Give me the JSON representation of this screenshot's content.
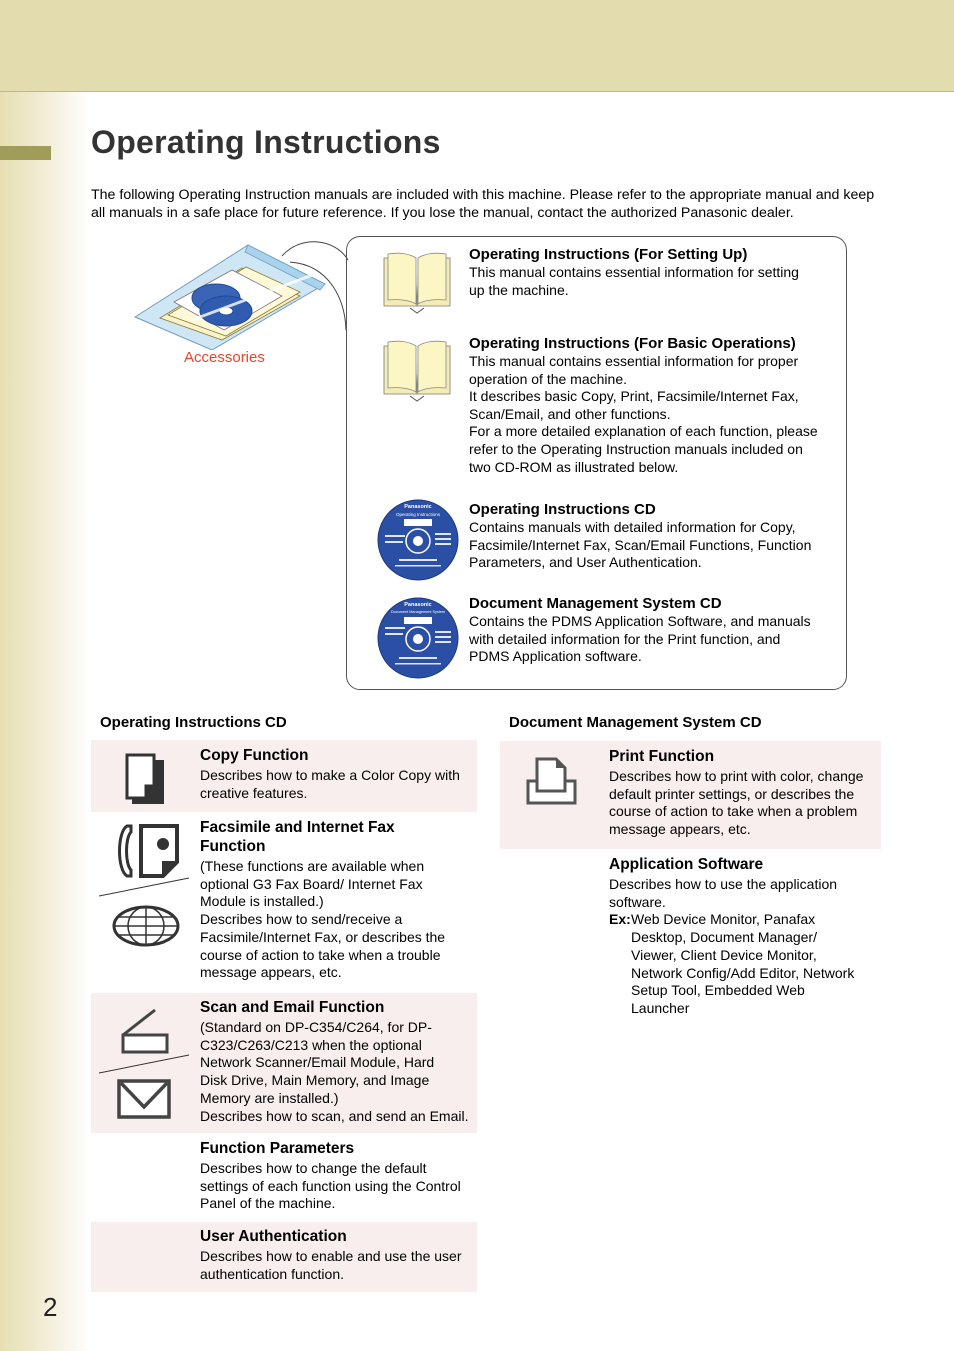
{
  "page": {
    "title": "Operating Instructions",
    "intro": "The following Operating Instruction manuals are included with this machine. Please refer to the appropriate manual and keep all manuals in a safe place for future reference. If you lose the manual, contact the authorized Panasonic dealer.",
    "page_number": "2"
  },
  "accessories": {
    "label": "Accessories",
    "label_color": "#e8452a"
  },
  "manuals": [
    {
      "icon": "book-icon",
      "title": "Operating Instructions (For Setting Up)",
      "lines": [
        "This manual contains essential information for setting",
        "up the machine."
      ]
    },
    {
      "icon": "book-icon",
      "title": "Operating Instructions (For Basic Operations)",
      "lines": [
        "This manual contains essential information for proper",
        "operation of the machine.",
        "It describes basic Copy, Print, Facsimile/Internet Fax,",
        "Scan/Email, and other functions.",
        "For a more detailed explanation of each function, please",
        "refer to the Operating Instruction manuals included on",
        "two CD-ROM as illustrated below."
      ]
    },
    {
      "icon": "cd-icon",
      "cd_brand": "Panasonic",
      "cd_label": "Operating Instructions",
      "title": "Operating Instructions CD",
      "lines": [
        "Contains manuals with detailed information for Copy,",
        "Facsimile/Internet Fax, Scan/Email Functions, Function",
        "Parameters, and User Authentication."
      ]
    },
    {
      "icon": "cd-icon",
      "cd_brand": "Panasonic",
      "cd_label": "Document Management System",
      "title": "Document Management System CD",
      "lines": [
        "Contains the PDMS Application Software, and manuals",
        "with detailed information for the Print function, and",
        "PDMS Application software."
      ]
    }
  ],
  "oi_cd": {
    "heading": "Operating Instructions CD",
    "items": [
      {
        "icon": "copy-icon",
        "title": "Copy Function",
        "lines": [
          "Describes how to make a Color Copy with",
          "creative features."
        ]
      },
      {
        "icon": "fax-icon / globe-icon",
        "title": "Facsimile and Internet Fax Function",
        "lines": [
          "(These functions are available when",
          "optional G3 Fax Board/ Internet Fax",
          "Module is installed.)",
          "Describes how to send/receive a",
          "Facsimile/Internet Fax, or describes the",
          "course of action to take when a trouble",
          "message appears, etc."
        ]
      },
      {
        "icon": "scanner-icon / envelope-icon",
        "title": "Scan and Email Function",
        "lines": [
          "(Standard on DP-C354/C264, for DP-",
          "C323/C263/C213 when the optional",
          "Network Scanner/Email Module, Hard",
          "Disk Drive, Main Memory, and Image",
          "Memory are installed.)",
          "Describes how to scan, and send an Email."
        ]
      },
      {
        "title": "Function Parameters",
        "lines": [
          "Describes how to change the default",
          "settings of each function using the Control",
          "Panel of the machine."
        ]
      },
      {
        "title": "User Authentication",
        "lines": [
          "Describes how to enable and use the user",
          "authentication function."
        ]
      }
    ]
  },
  "dms_cd": {
    "heading": "Document Management System CD",
    "items": [
      {
        "icon": "print-icon",
        "title": "Print Function",
        "lines": [
          "Describes how to print with color, change",
          "default printer settings, or describes the",
          "course of action to take when a problem",
          "message appears, etc."
        ]
      },
      {
        "title": "Application Software",
        "lines": [
          "Describes how to use the application",
          "software."
        ],
        "ex_label": "Ex",
        "ex_sep": ":",
        "ex_lines": [
          "Web Device Monitor, Panafax",
          "Desktop, Document Manager/",
          "Viewer, Client Device Monitor,",
          "Network Config/Add Editor, Network",
          "Setup Tool, Embedded Web",
          "Launcher"
        ]
      }
    ]
  },
  "colors": {
    "top_band": "#e3dcae",
    "side_tab": "#a09d5a",
    "row_highlight": "#f9eeee",
    "title_text": "#333333",
    "cd_blue": "#2a4fa5",
    "book_paper": "#fbf6c4"
  }
}
